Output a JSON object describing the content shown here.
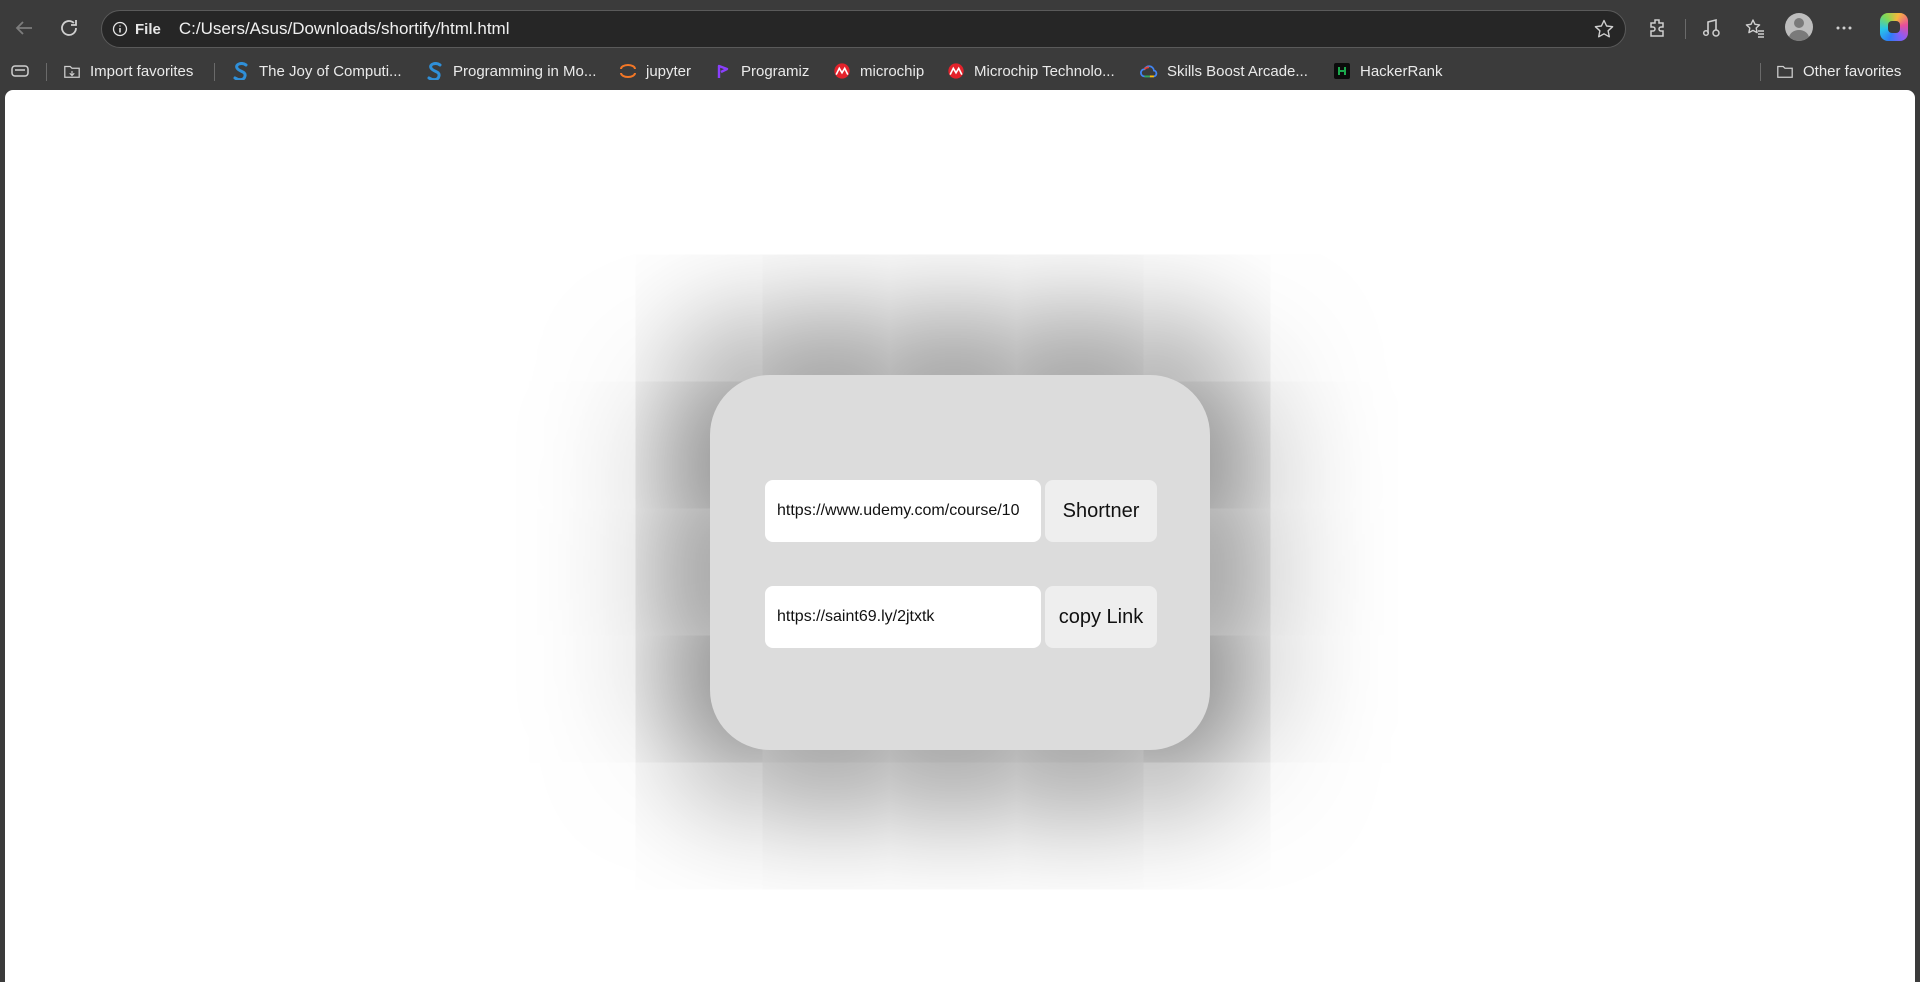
{
  "browser": {
    "address_prefix": "File",
    "url": "C:/Users/Asus/Downloads/shortify/html.html"
  },
  "favorites": [
    {
      "label": "Import favorites",
      "icon": "import-favorites-icon"
    },
    {
      "label": "The Joy of Computi...",
      "icon": "swayam-icon"
    },
    {
      "label": "Programming in Mo...",
      "icon": "swayam-icon"
    },
    {
      "label": "jupyter",
      "icon": "jupyter-icon"
    },
    {
      "label": "Programiz",
      "icon": "programiz-icon"
    },
    {
      "label": "microchip",
      "icon": "microchip-icon"
    },
    {
      "label": "Microchip Technolo...",
      "icon": "microchip-icon"
    },
    {
      "label": "Skills Boost Arcade...",
      "icon": "google-cloud-icon"
    },
    {
      "label": "HackerRank",
      "icon": "hackerrank-icon"
    },
    {
      "label": "Other favorites",
      "icon": "folder-icon"
    }
  ],
  "shortener": {
    "long_url_value": "https://www.udemy.com/course/10",
    "shorten_button": "Shortner",
    "short_url_value": "https://saint69.ly/2jtxtk",
    "copy_button": "copy Link"
  },
  "colors": {
    "browser_chrome": "#3b3b3b",
    "card_background": "#dcdcdc",
    "button_background": "#eeeeee"
  }
}
